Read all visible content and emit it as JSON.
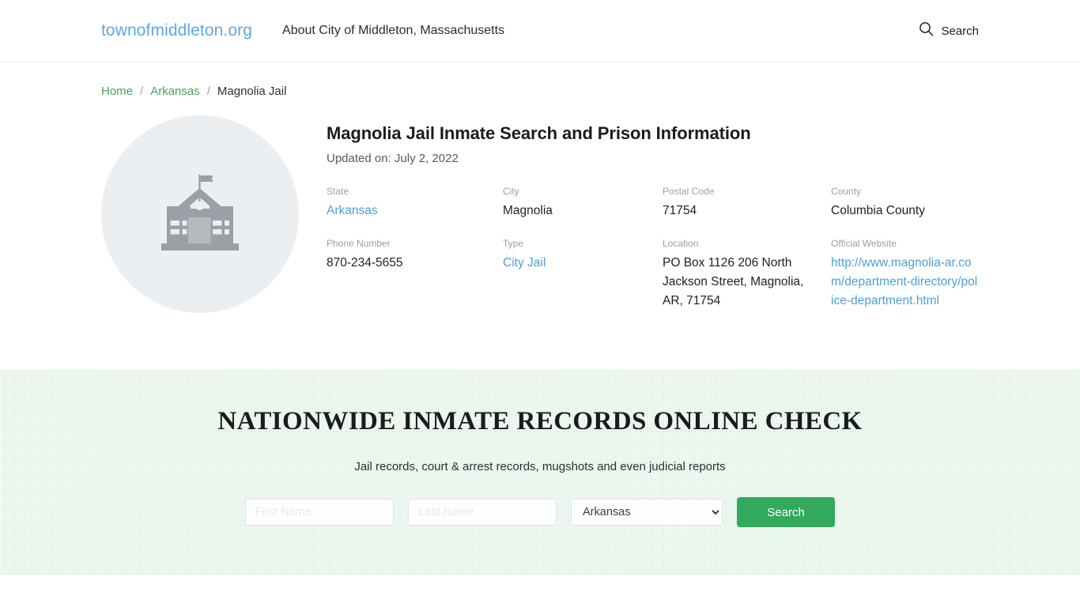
{
  "header": {
    "brand": "townofmiddleton.org",
    "tagline": "About City of Middleton, Massachusetts",
    "search_label": "Search",
    "search_icon": "search-icon"
  },
  "breadcrumb": {
    "home": "Home",
    "state": "Arkansas",
    "current": "Magnolia Jail",
    "separator": "/"
  },
  "profile": {
    "avatar_icon": "government-building-icon",
    "title": "Magnolia Jail Inmate Search and Prison Information",
    "updated": "Updated on: July 2, 2022",
    "fields": [
      {
        "label": "State",
        "value": "Arkansas",
        "link": true
      },
      {
        "label": "City",
        "value": "Magnolia",
        "link": false
      },
      {
        "label": "Postal Code",
        "value": "71754",
        "link": false
      },
      {
        "label": "County",
        "value": "Columbia County",
        "link": false
      },
      {
        "label": "Phone Number",
        "value": "870-234-5655",
        "link": false
      },
      {
        "label": "Type",
        "value": "City Jail",
        "link": true
      },
      {
        "label": "Location",
        "value": "PO Box 1126 206 North Jackson Street, Magnolia, AR, 71754",
        "link": false
      },
      {
        "label": "Official Website",
        "value": "http://www.magnolia-ar.com/department-directory/police-department.html",
        "link": true
      }
    ]
  },
  "promo": {
    "title": "NATIONWIDE INMATE RECORDS ONLINE CHECK",
    "subtitle": "Jail records, court & arrest records, mugshots and even judicial reports",
    "first_name_value": "",
    "first_name_placeholder": "First Name",
    "last_name_value": "",
    "last_name_placeholder": "Last Name",
    "state_selected": "Arkansas",
    "state_options": [
      "Arkansas"
    ],
    "search_button": "Search"
  },
  "colors": {
    "brand_blue": "#5da9e2",
    "link_blue": "#4d9fd8",
    "crumb_green": "#4aa35e",
    "button_green": "#32a95c",
    "promo_bg": "#eaf6ee",
    "avatar_bg": "#eceff1"
  }
}
